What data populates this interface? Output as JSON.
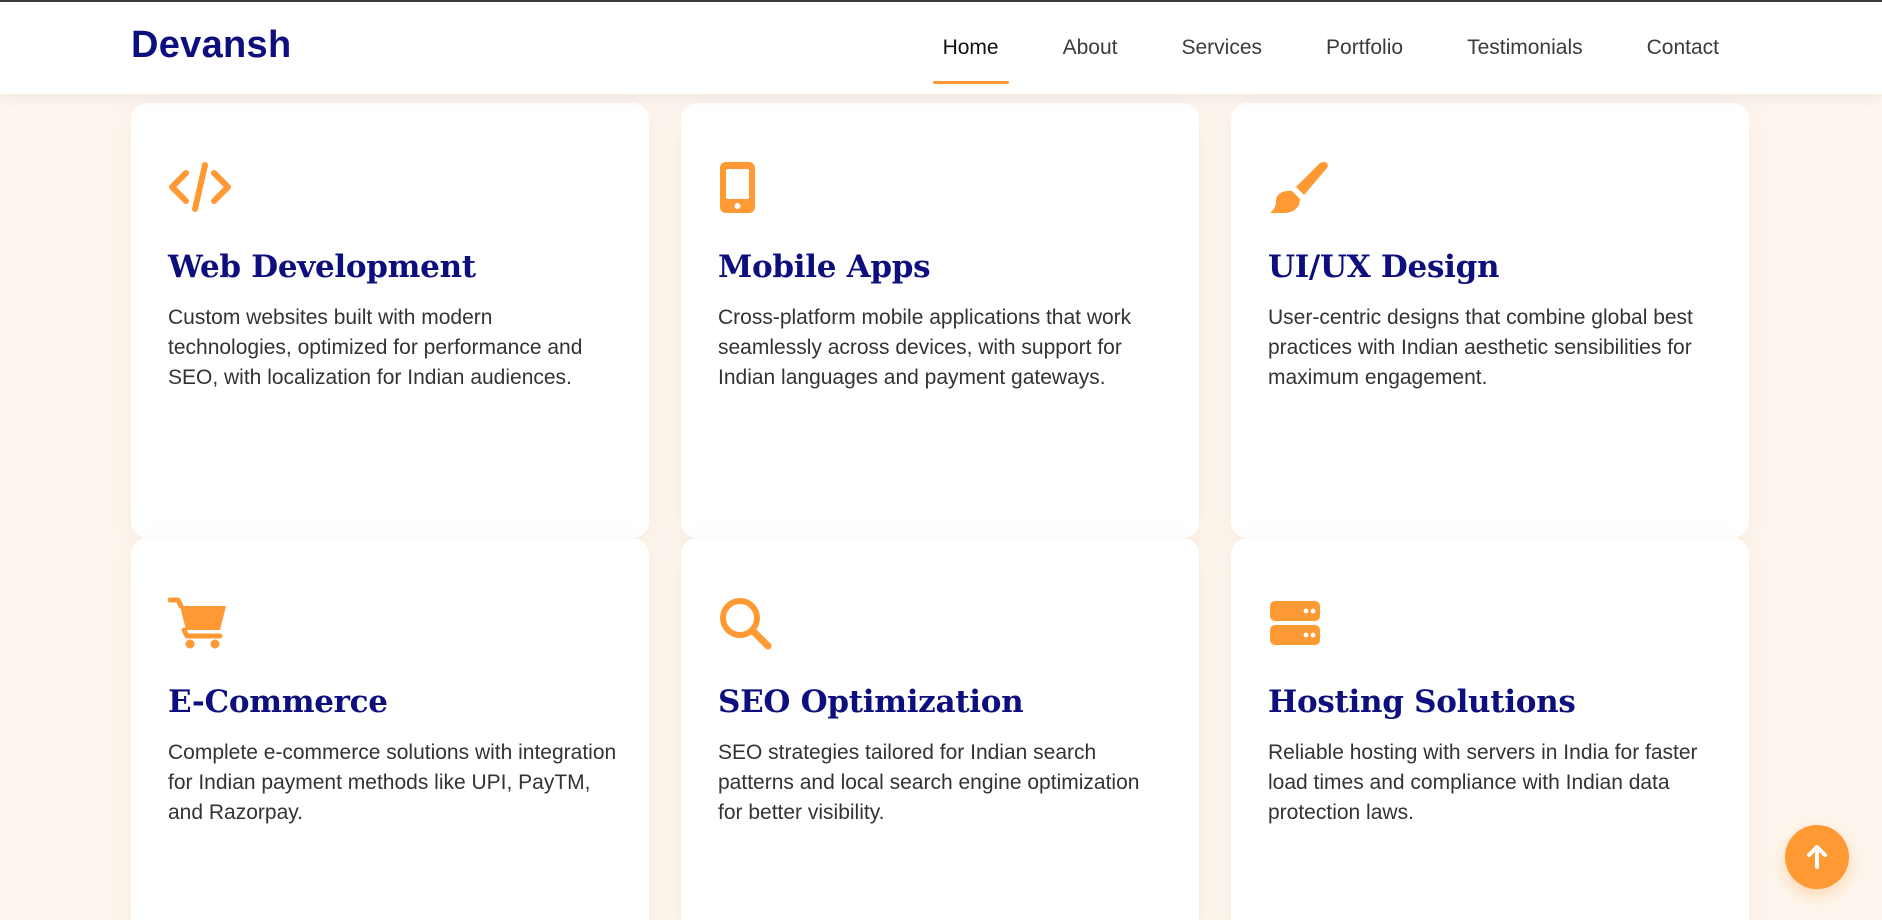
{
  "brand": {
    "logo": "Devansh",
    "navy": "#0e0f7e",
    "accent": "#ff9933"
  },
  "nav": {
    "items": [
      {
        "label": "Home",
        "active": true
      },
      {
        "label": "About"
      },
      {
        "label": "Services"
      },
      {
        "label": "Portfolio"
      },
      {
        "label": "Testimonials"
      },
      {
        "label": "Contact"
      }
    ]
  },
  "services": [
    {
      "icon": "code-icon",
      "title": "Web Development",
      "text": "Custom websites built with modern technologies, optimized for performance and SEO, with localization for Indian audiences."
    },
    {
      "icon": "mobile-phone-icon",
      "title": "Mobile Apps",
      "text": "Cross-platform mobile applications that work seamlessly across devices, with support for Indian languages and payment gateways."
    },
    {
      "icon": "paint-brush-icon",
      "title": "UI/UX Design",
      "text": "User-centric designs that combine global best practices with Indian aesthetic sensibilities for maximum engagement."
    },
    {
      "icon": "shopping-cart-icon",
      "title": "E-Commerce",
      "text": "Complete e-commerce solutions with integration for Indian payment methods like UPI, PayTM, and Razorpay."
    },
    {
      "icon": "search-icon",
      "title": "SEO Optimization",
      "text": "SEO strategies tailored for Indian search patterns and local search engine optimization for better visibility."
    },
    {
      "icon": "server-icon",
      "title": "Hosting Solutions",
      "text": "Reliable hosting with servers in India for faster load times and compliance with Indian data protection laws."
    }
  ],
  "scroll_top": {
    "icon": "arrow-up-icon"
  }
}
